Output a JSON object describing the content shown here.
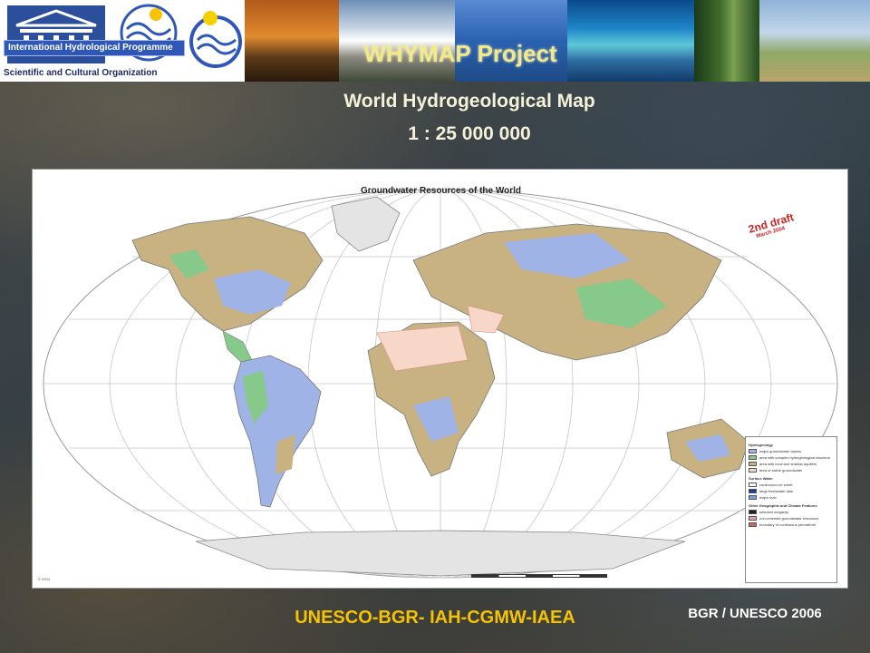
{
  "header": {
    "org_text": "Scientific and Cultural Organization",
    "ihp_label": "International Hydrological Programme",
    "project_title": "WHYMAP Project",
    "subtitle": "World Hydrogeological Map",
    "scale": "1 : 25 000 000"
  },
  "map": {
    "title": "Groundwater Resources of the World",
    "draft_label": "2nd draft",
    "draft_date": "March 2004",
    "copyright": "© 2004",
    "legend": {
      "hydrogeology_heading": "Hydrogeology",
      "hydrogeology_items": [
        {
          "label": "major groundwater basins",
          "color": "#9fb3e6"
        },
        {
          "label": "area with complex hydrogeological structure",
          "color": "#86c98a"
        },
        {
          "label": "area with local and shallow aquifers",
          "color": "#c8b282"
        },
        {
          "label": "area of saline groundwater",
          "color": "#f6d7c8"
        }
      ],
      "surface_water_heading": "Surface Water",
      "surface_water_items": [
        {
          "label": "continuous ice sheet",
          "color": "#ffffff"
        },
        {
          "label": "large freshwater lake",
          "color": "#1b3c9c"
        },
        {
          "label": "major river",
          "color": "#7a9be0"
        }
      ],
      "other_heading": "Other Geographic and Climate Features",
      "other_items": [
        {
          "label": "selected megacity",
          "color": "#222222"
        },
        {
          "label": "non-renewed groundwater resources",
          "color": "#e6a0a0"
        },
        {
          "label": "boundary of continuous permafrost",
          "color": "#cc6666"
        }
      ]
    }
  },
  "footer": {
    "partners": "UNESCO-BGR- IAH-CGMW-IAEA",
    "credit": "BGR / UNESCO 2006"
  },
  "colors": {
    "title_yellow": "#f3e98a",
    "footer_gold": "#f5c300",
    "groundwater_blue": "#9fb3e6",
    "complex_green": "#86c98a",
    "local_tan": "#c8b282"
  }
}
